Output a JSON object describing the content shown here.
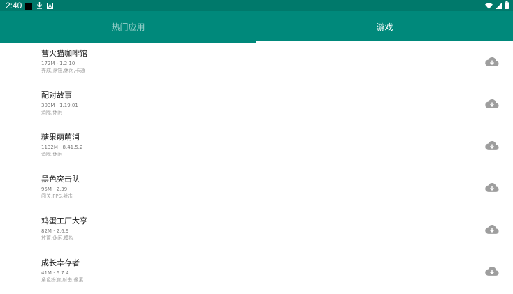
{
  "status_bar": {
    "time": "2:40",
    "left_icons": [
      "black-square-icon",
      "download-icon",
      "a-icon"
    ],
    "right_icons": [
      "wifi-icon",
      "signal-icon",
      "battery-icon"
    ]
  },
  "tabs": [
    {
      "label": "热门应用",
      "selected": false
    },
    {
      "label": "游戏",
      "selected": true
    }
  ],
  "games": [
    {
      "title": "营火猫咖啡馆",
      "meta": "172M · 1.2.10",
      "tags": "养成,烹饪,休闲,卡通"
    },
    {
      "title": "配对故事",
      "meta": "303M · 1.19.01",
      "tags": "消除,休闲"
    },
    {
      "title": "糖果萌萌消",
      "meta": "1132M · 8.41.5.2",
      "tags": "消除,休闲"
    },
    {
      "title": "黑色突击队",
      "meta": "95M · 2.39",
      "tags": "闯关,FPS,射击"
    },
    {
      "title": "鸡蛋工厂大亨",
      "meta": "82M · 2.6.9",
      "tags": "放置,休闲,模拟"
    },
    {
      "title": "成长幸存者",
      "meta": "41M · 6.7.4",
      "tags": "角色扮演,射击,像素"
    }
  ],
  "colors": {
    "status_bar": "#00796b",
    "app_bar": "#00897b",
    "icon_grey": "#9e9e9e"
  }
}
